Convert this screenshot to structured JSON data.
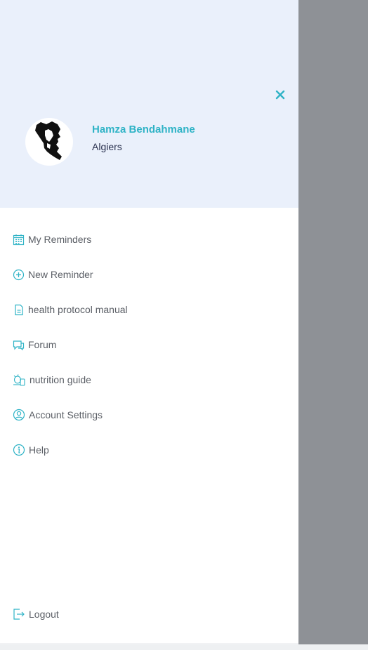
{
  "profile": {
    "name": "Hamza Bendahmane",
    "city": "Algiers"
  },
  "menu": {
    "items": [
      {
        "label": "My Reminders",
        "icon": "calendar-icon"
      },
      {
        "label": "New Reminder",
        "icon": "plus-circle-icon"
      },
      {
        "label": "health protocol manual",
        "icon": "document-icon"
      },
      {
        "label": "Forum",
        "icon": "chat-icon"
      },
      {
        "label": "nutrition guide",
        "icon": "nutrition-icon"
      },
      {
        "label": "Account Settings",
        "icon": "user-circle-icon"
      },
      {
        "label": "Help",
        "icon": "info-icon"
      }
    ],
    "logout_label": "Logout"
  },
  "colors": {
    "accent": "#2fb3c6",
    "header_bg": "#eaf0fb",
    "overlay": "#8e9196",
    "menu_text": "#5b5f66"
  }
}
